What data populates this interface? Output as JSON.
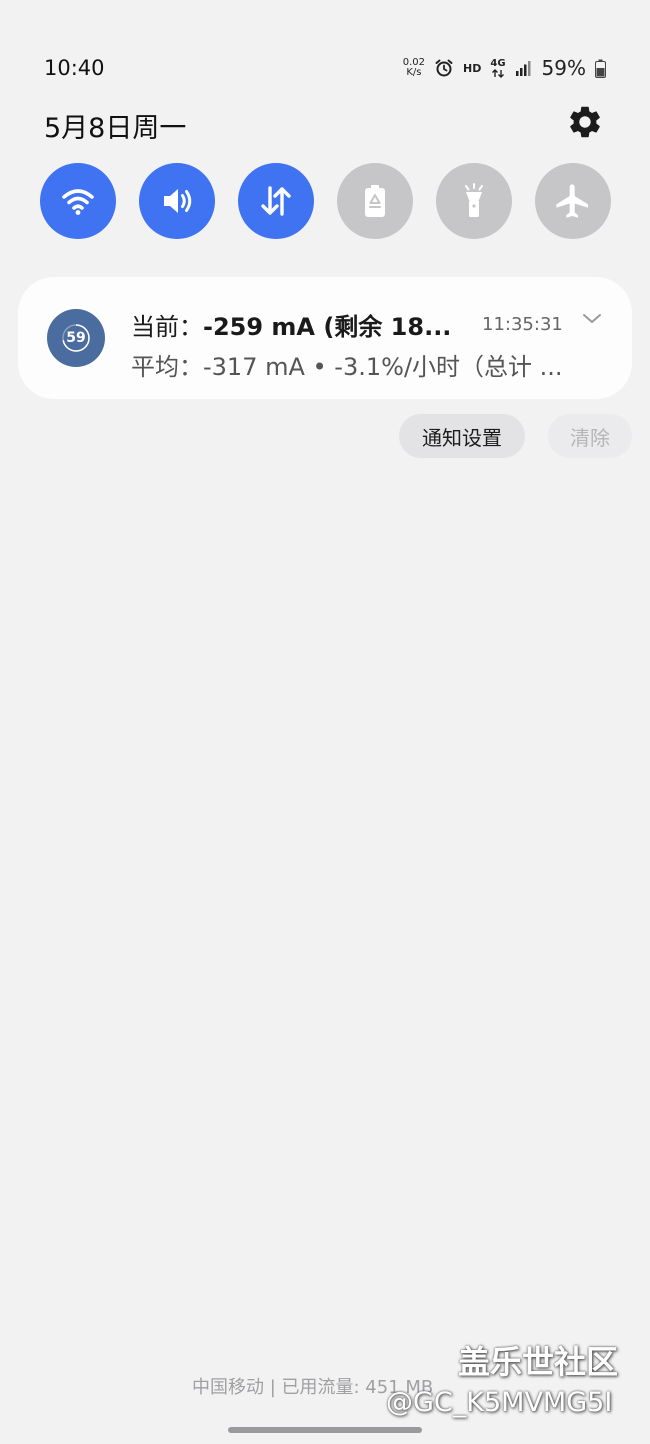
{
  "status_bar": {
    "time": "10:40",
    "net_speed_value": "0.02",
    "net_speed_unit": "K/s",
    "hd_label": "HD",
    "network_type": "4G",
    "battery_percent": "59%",
    "icons": [
      "alarm-icon",
      "cellular-signal-icon",
      "battery-icon"
    ]
  },
  "header": {
    "date": "5月8日周一",
    "settings_icon": "gear-icon"
  },
  "quick_toggles": [
    {
      "name": "wifi",
      "icon": "wifi-icon",
      "state": "on"
    },
    {
      "name": "sound",
      "icon": "speaker-icon",
      "state": "on"
    },
    {
      "name": "mobile-data",
      "icon": "data-arrows-icon",
      "state": "on"
    },
    {
      "name": "power-saving",
      "icon": "battery-recycle-icon",
      "state": "off"
    },
    {
      "name": "flashlight",
      "icon": "flashlight-icon",
      "state": "off"
    },
    {
      "name": "airplane-mode",
      "icon": "airplane-icon",
      "state": "off"
    }
  ],
  "notification": {
    "app_icon_text": "59",
    "title_label": "当前：",
    "title_value": "-259 mA (剩余 18...",
    "time": "11:35:31",
    "body": "平均：-317 mA • -3.1%/小时（总计 ...",
    "expand_icon": "chevron-down-icon"
  },
  "actions": {
    "notification_settings": "通知设置",
    "clear": "清除"
  },
  "footer": {
    "carrier_info": "中国移动 | 已用流量: 451 MB"
  },
  "watermark": {
    "site_name": "盖乐世社区",
    "user_id": "@GC_K5MVMG5I"
  },
  "colors": {
    "background": "#f2f2f3",
    "toggle_on": "#3f73f1",
    "toggle_off": "#c6c6c8",
    "card": "#fdfdfd",
    "app_icon": "#4a6c9e"
  }
}
